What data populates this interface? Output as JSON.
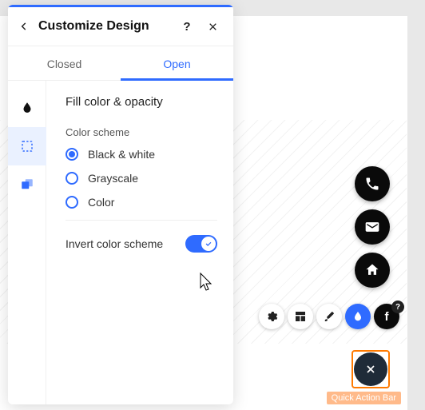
{
  "panel": {
    "title": "Customize Design",
    "tabs": {
      "closed": "Closed",
      "open": "Open"
    },
    "section_title": "Fill color & opacity",
    "color_scheme_label": "Color scheme",
    "options": {
      "bw": "Black & white",
      "gray": "Grayscale",
      "color": "Color"
    },
    "invert_label": "Invert color scheme"
  },
  "qab_label": "Quick Action Bar"
}
